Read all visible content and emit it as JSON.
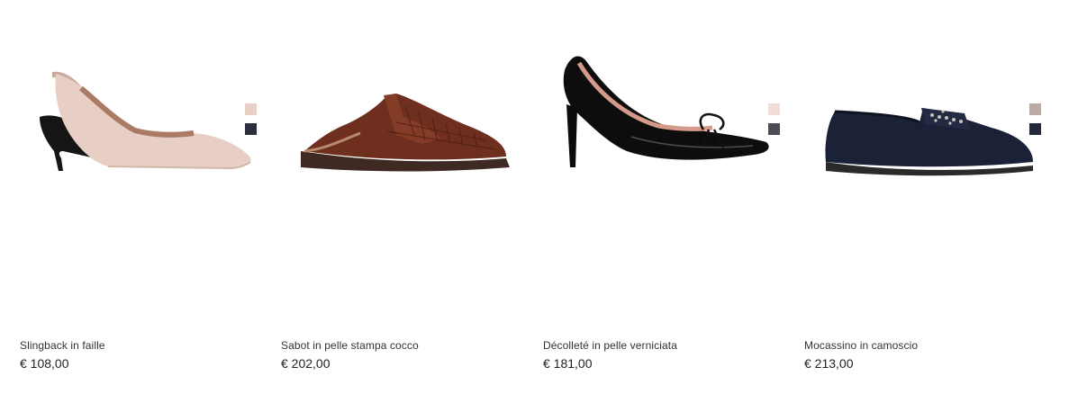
{
  "products": [
    {
      "name": "Slingback in faille",
      "price": "€ 108,00",
      "swatches": [
        "#e9cfc5",
        "#2c2f3e"
      ]
    },
    {
      "name": "Sabot in pelle stampa cocco",
      "price": "€ 202,00",
      "swatches": []
    },
    {
      "name": "Décolleté in pelle verniciata",
      "price": "€ 181,00",
      "swatches": [
        "#f2ddd6",
        "#4a4d55"
      ]
    },
    {
      "name": "Mocassino in camoscio",
      "price": "€ 213,00",
      "swatches": [
        "#b9aaa3",
        "#23283b"
      ]
    }
  ]
}
